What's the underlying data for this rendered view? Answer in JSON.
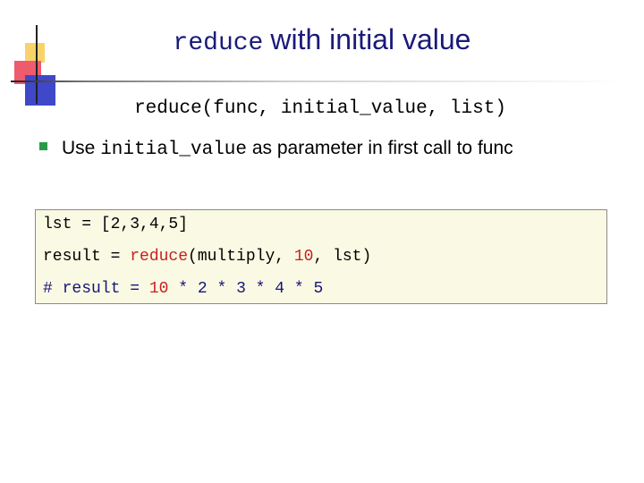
{
  "slide": {
    "title_code": "reduce",
    "title_text": "with initial value",
    "signature": "reduce(func, initial_value, list)",
    "bullet": {
      "pre": "Use ",
      "code": "initial_value",
      "post": " as parameter in first call to func"
    },
    "code": {
      "line1": "lst = [2,3,4,5]",
      "line2_pre": "result = ",
      "line2_func": "reduce",
      "line2_mid": "(multiply, ",
      "line2_num": "10",
      "line2_post": ", lst)",
      "line3_hash": "#",
      "line3_pre": " result = ",
      "line3_num": "10",
      "line3_post": " * 2 * 3 * 4 * 5"
    }
  },
  "colors": {
    "title": "#1a1a7a",
    "bullet": "#2a9a4a",
    "code_background": "#fafae4",
    "highlight_red": "#c8201e"
  }
}
